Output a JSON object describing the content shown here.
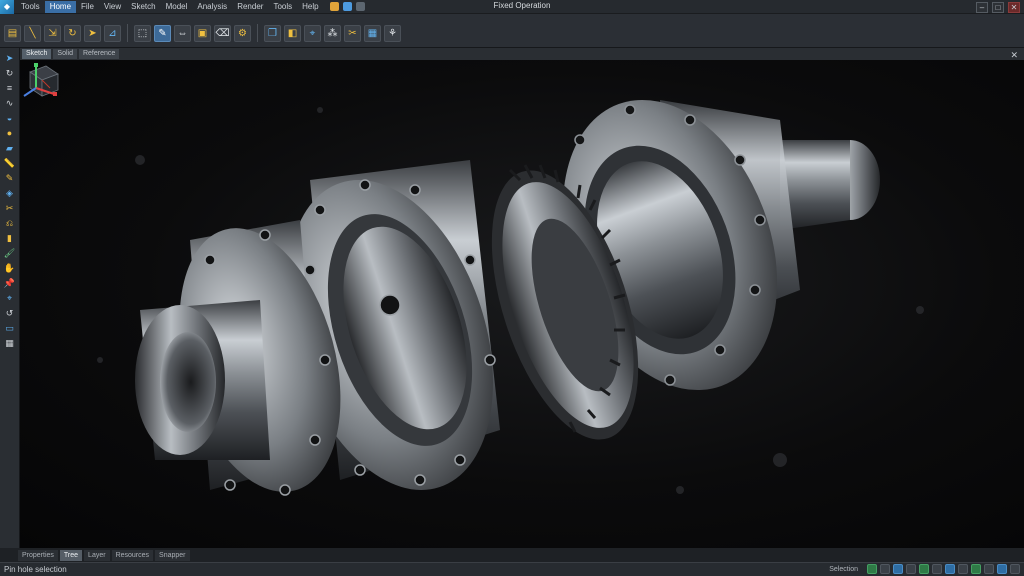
{
  "window": {
    "title": "Fixed Operation",
    "controls": [
      "–",
      "□",
      "✕"
    ]
  },
  "menu": [
    "Tools",
    "Home",
    "File",
    "View",
    "Sketch",
    "Model",
    "Analysis",
    "Render",
    "Tools",
    "Help"
  ],
  "menu_active_index": 1,
  "toolbar": {
    "icons": [
      "folder-icon",
      "line-icon",
      "move-icon",
      "rotate-icon",
      "arrow-icon",
      "measure-icon",
      "select-icon",
      "sketch-icon",
      "dimension-icon",
      "extrude-icon",
      "eraser-icon",
      "gear-icon",
      "copy-icon",
      "view-icon",
      "snap-icon",
      "pattern-icon",
      "clip-icon",
      "grid-icon",
      "assembly-icon"
    ],
    "active_index": 7
  },
  "viewport_tabs": [
    "Sketch",
    "Solid",
    "Reference"
  ],
  "viewport_tab_active": 0,
  "viewport_close": "✕",
  "left_tools": [
    "select",
    "rotate",
    "layers",
    "curve",
    "surface",
    "sphere",
    "shape",
    "measure",
    "pencil",
    "mirror",
    "cut",
    "fold",
    "extrude",
    "paint",
    "hand",
    "pin",
    "snap",
    "rotate2",
    "screen",
    "grid"
  ],
  "sheet_tabs": [
    "Properties",
    "Tree",
    "Layer",
    "Resources",
    "Snapper"
  ],
  "sheet_tab_active": 1,
  "status": {
    "text": "Pin hole selection",
    "right_label": "Selection",
    "indicators": [
      "grid",
      "snap",
      "ortho",
      "polar",
      "track",
      "lw",
      "model",
      "annot",
      "iso",
      "visual",
      "ws",
      "clean"
    ]
  },
  "colors": {
    "accent": "#3d6a98",
    "toolbar_icon": "#f0c040",
    "viewport_bg": "#0b0b0c"
  }
}
